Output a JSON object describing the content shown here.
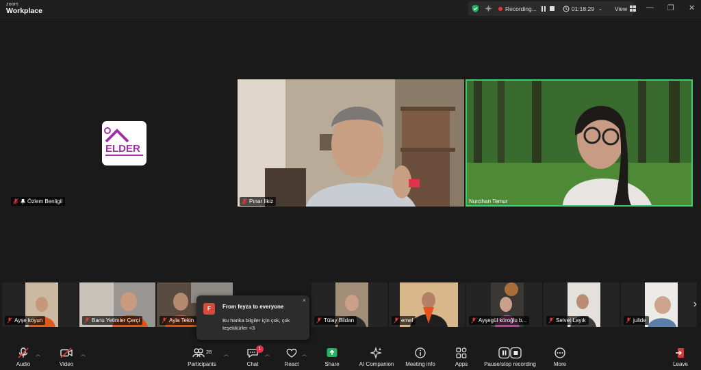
{
  "app": {
    "brand_small": "zoom",
    "brand_large": "Workplace"
  },
  "recording_bar": {
    "status": "Recording...",
    "elapsed": "01:18:29",
    "view_label": "View"
  },
  "speakers": {
    "pinned": {
      "name": "Özlem Benligil",
      "logo_text": "ELDER"
    },
    "video1": {
      "name": "Pınar İlkiz"
    },
    "video2": {
      "name": "Nurcihan Temur",
      "active_color": "#3ccf6e"
    }
  },
  "thumbnails": [
    {
      "name": "Ayşe koyun"
    },
    {
      "name": "Banu Yetimler Çerçi"
    },
    {
      "name": "Ayla Tekin"
    },
    {
      "name": "Tülay Bildan"
    },
    {
      "name": "emel"
    },
    {
      "name": "Ayşegül köroğlu b..."
    },
    {
      "name": "Selvet Layık"
    },
    {
      "name": "julide"
    }
  ],
  "chat_popup": {
    "avatar_letter": "F",
    "from": "From feyza to everyone",
    "message": "Bu harika bilgiler için çok, çok teşekkürler <3",
    "close": "×"
  },
  "toolbar": {
    "audio": "Audio",
    "video": "Video",
    "participants": "Participants",
    "participants_count": "28",
    "chat": "Chat",
    "chat_badge": "1",
    "react": "React",
    "share": "Share",
    "ai_companion": "AI Companion",
    "meeting_info": "Meeting info",
    "apps": "Apps",
    "pause_recording": "Pause/stop recording",
    "more": "More",
    "leave": "Leave"
  },
  "colors": {
    "muted_red": "#e33b3b",
    "share_green": "#23b35f",
    "active_speaker": "#3ccf6e"
  }
}
